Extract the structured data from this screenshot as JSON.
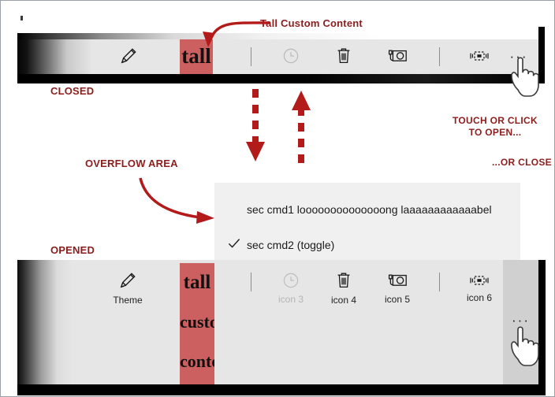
{
  "annotations": {
    "tall_custom_content": "Tall Custom Content",
    "closed": "CLOSED",
    "opened": "OPENED",
    "overflow_area": "OVERFLOW AREA",
    "touch_or_click": "TOUCH OR CLICK\nTO OPEN...",
    "or_close": "...OR CLOSE"
  },
  "colors": {
    "annotation_red": "#8c1d1d",
    "arrow_red": "#b31b1b",
    "chip_red": "#cc6060",
    "bar_bg": "#e6e6e6",
    "flyout_bg": "#f0f0f0",
    "overflow_hot": "#d0d0d0",
    "disabled_text": "#b5b5b5"
  },
  "closed_bar": {
    "items": [
      {
        "icon": "pencil-icon",
        "label": ""
      },
      {
        "icon": "tall-custom-content",
        "label": "tall"
      },
      {
        "icon": "separator",
        "label": ""
      },
      {
        "icon": "clock-icon",
        "label": "",
        "disabled": true
      },
      {
        "icon": "trash-icon",
        "label": ""
      },
      {
        "icon": "camera-icon",
        "label": ""
      },
      {
        "icon": "separator",
        "label": ""
      },
      {
        "icon": "resize-icon",
        "label": ""
      }
    ],
    "overflow_label": "···"
  },
  "opened_bar": {
    "items": [
      {
        "icon": "pencil-icon",
        "label": "Theme",
        "disabled": false
      },
      {
        "icon": "clock-icon",
        "label": "icon 3",
        "disabled": true
      },
      {
        "icon": "trash-icon",
        "label": "icon 4",
        "disabled": false
      },
      {
        "icon": "camera-icon",
        "label": "icon 5",
        "disabled": false
      },
      {
        "icon": "resize-icon",
        "label": "icon 6",
        "disabled": false
      }
    ],
    "tall_content_lines": [
      "tall",
      "custom",
      "content"
    ],
    "overflow_label": "···"
  },
  "flyout": {
    "items": [
      {
        "label": "sec cmd1 loooooooooooooong laaaaaaaaaaaabel",
        "checked": false
      },
      {
        "label": "sec cmd2 (toggle)",
        "checked": true
      }
    ]
  }
}
